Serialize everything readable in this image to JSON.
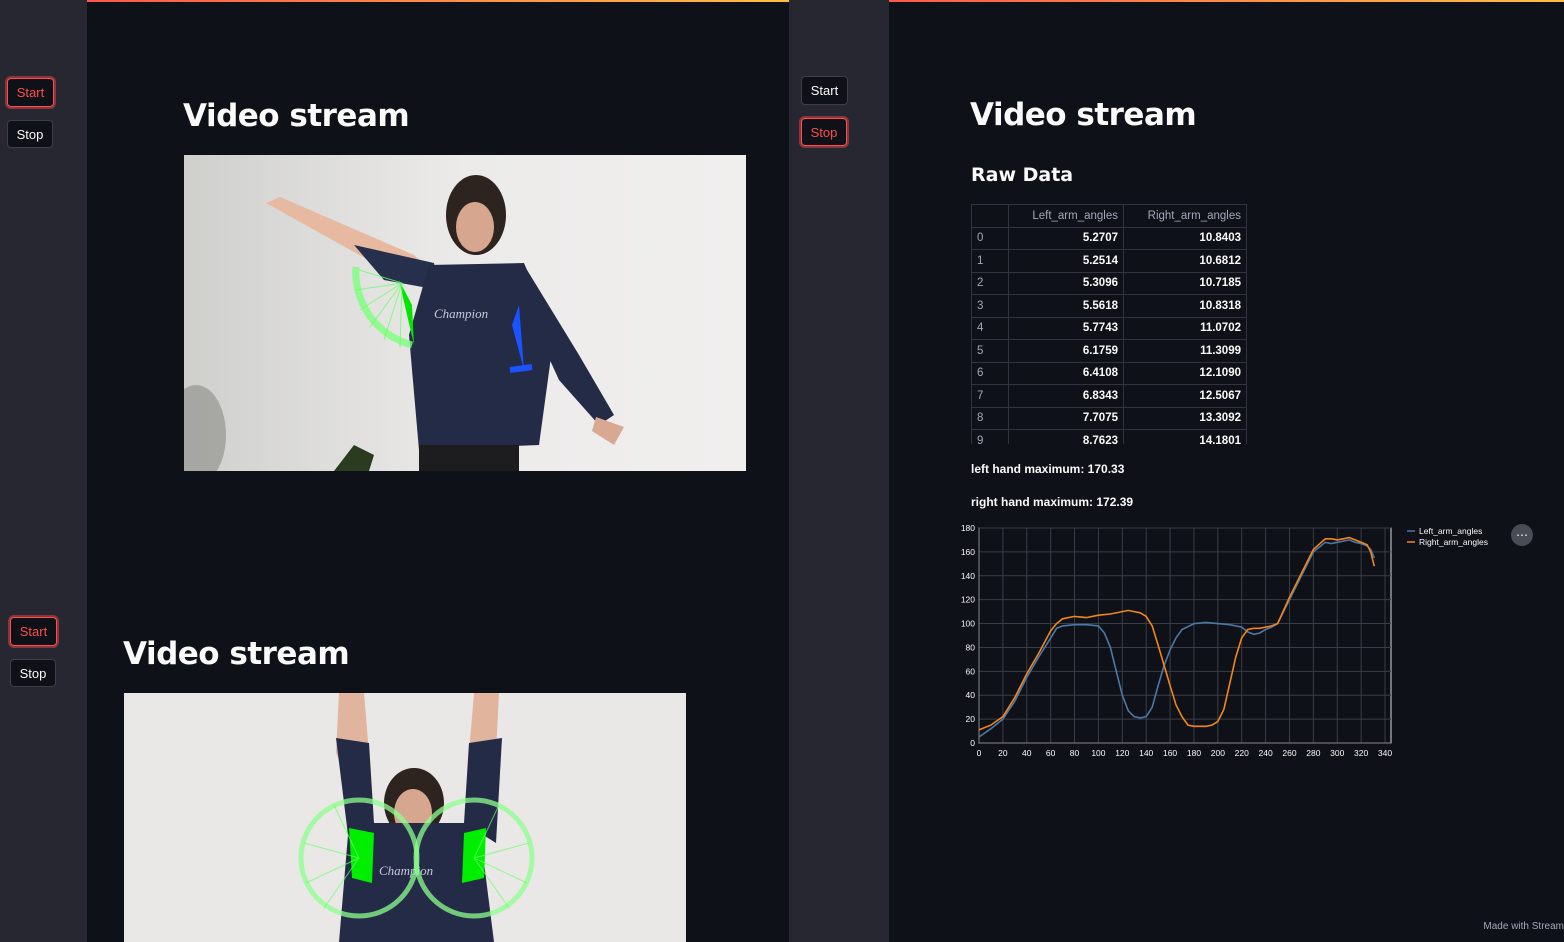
{
  "colors": {
    "accent": "#ff4b4b",
    "background": "#0e1117",
    "sidebar": "#262730",
    "left_series": "#4c78a8",
    "right_series": "#f58518"
  },
  "left_app": {
    "panel1": {
      "start_label": "Start",
      "stop_label": "Stop",
      "active_button": "start",
      "heading": "Video stream"
    },
    "panel2": {
      "start_label": "Start",
      "stop_label": "Stop",
      "active_button": "start",
      "heading": "Video stream"
    }
  },
  "right_app": {
    "start_label": "Start",
    "stop_label": "Stop",
    "active_button": "stop",
    "heading": "Video stream",
    "subheading": "Raw Data",
    "table": {
      "columns": [
        "",
        "Left_arm_angles",
        "Right_arm_angles"
      ],
      "rows": [
        [
          "0",
          "5.2707",
          "10.8403"
        ],
        [
          "1",
          "5.2514",
          "10.6812"
        ],
        [
          "2",
          "5.3096",
          "10.7185"
        ],
        [
          "3",
          "5.5618",
          "10.8318"
        ],
        [
          "4",
          "5.7743",
          "11.0702"
        ],
        [
          "5",
          "6.1759",
          "11.3099"
        ],
        [
          "6",
          "6.4108",
          "12.1090"
        ],
        [
          "7",
          "6.8343",
          "12.5067"
        ],
        [
          "8",
          "7.7075",
          "13.3092"
        ],
        [
          "9",
          "8.7623",
          "14.1801"
        ]
      ]
    },
    "left_max_text": "left hand maximum: 170.33",
    "right_max_text": "right hand maximum: 172.39",
    "footer_text": "Made with Stream"
  },
  "chart_data": {
    "type": "line",
    "xlim": [
      0,
      345
    ],
    "ylim": [
      0,
      180
    ],
    "x_ticks": [
      0,
      20,
      40,
      60,
      80,
      100,
      120,
      140,
      160,
      180,
      200,
      220,
      240,
      260,
      280,
      300,
      320,
      340
    ],
    "y_ticks": [
      0,
      20,
      40,
      60,
      80,
      100,
      120,
      140,
      160,
      180
    ],
    "grid": true,
    "legend_position": "right",
    "series": [
      {
        "name": "Left_arm_angles",
        "color": "#4c78a8",
        "x": [
          0,
          10,
          20,
          30,
          40,
          50,
          60,
          65,
          70,
          80,
          90,
          100,
          105,
          110,
          115,
          120,
          125,
          130,
          135,
          140,
          145,
          150,
          155,
          160,
          165,
          170,
          180,
          190,
          200,
          210,
          220,
          225,
          230,
          235,
          240,
          245,
          250,
          260,
          270,
          280,
          290,
          295,
          300,
          305,
          310,
          315,
          320,
          325,
          328,
          331
        ],
        "y": [
          5,
          12,
          20,
          35,
          55,
          72,
          88,
          96,
          98,
          99,
          99,
          98,
          92,
          80,
          60,
          40,
          27,
          22,
          21,
          22,
          30,
          48,
          65,
          78,
          88,
          95,
          100,
          101,
          100,
          99,
          97,
          93,
          91,
          92,
          95,
          97,
          100,
          120,
          140,
          160,
          168,
          167,
          168,
          169,
          170,
          168,
          167,
          165,
          162,
          155
        ]
      },
      {
        "name": "Right_arm_angles",
        "color": "#f58518",
        "x": [
          0,
          10,
          20,
          30,
          40,
          50,
          60,
          65,
          70,
          80,
          90,
          100,
          110,
          120,
          125,
          130,
          135,
          140,
          145,
          150,
          155,
          160,
          165,
          170,
          175,
          180,
          185,
          190,
          195,
          200,
          205,
          210,
          215,
          220,
          225,
          230,
          235,
          240,
          245,
          250,
          260,
          270,
          280,
          290,
          295,
          300,
          305,
          310,
          315,
          320,
          325,
          328,
          331
        ],
        "y": [
          11,
          15,
          22,
          38,
          58,
          75,
          94,
          100,
          104,
          106,
          105,
          107,
          108,
          110,
          111,
          110,
          109,
          106,
          98,
          82,
          65,
          48,
          32,
          22,
          15,
          14,
          14,
          14,
          15,
          18,
          28,
          50,
          72,
          88,
          95,
          96,
          96,
          97,
          98,
          100,
          122,
          142,
          162,
          171,
          171,
          170,
          171,
          172,
          170,
          168,
          166,
          160,
          148
        ]
      }
    ]
  }
}
